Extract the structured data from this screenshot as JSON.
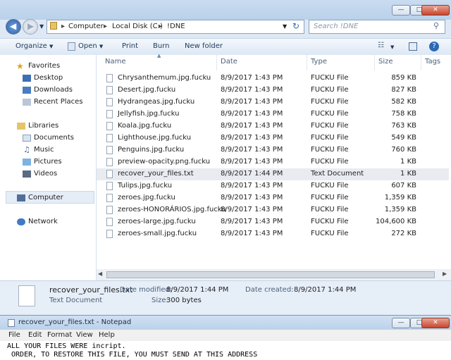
{
  "explorer": {
    "breadcrumb": [
      "Computer",
      "Local Disk (C:)",
      "!DNE"
    ],
    "search_placeholder": "Search !DNE",
    "toolbar": {
      "organize": "Organize",
      "open": "Open",
      "print": "Print",
      "burn": "Burn",
      "new_folder": "New folder"
    },
    "nav": {
      "favorites": "Favorites",
      "desktop": "Desktop",
      "downloads": "Downloads",
      "recent_places": "Recent Places",
      "libraries": "Libraries",
      "documents": "Documents",
      "music": "Music",
      "pictures": "Pictures",
      "videos": "Videos",
      "computer": "Computer",
      "network": "Network"
    },
    "columns": {
      "name": "Name",
      "date": "Date",
      "type": "Type",
      "size": "Size",
      "tags": "Tags"
    },
    "files": [
      {
        "name": "Chrysanthemum.jpg.fucku",
        "date": "8/9/2017 1:43 PM",
        "type": "FUCKU File",
        "size": "859 KB"
      },
      {
        "name": "Desert.jpg.fucku",
        "date": "8/9/2017 1:43 PM",
        "type": "FUCKU File",
        "size": "827 KB"
      },
      {
        "name": "Hydrangeas.jpg.fucku",
        "date": "8/9/2017 1:43 PM",
        "type": "FUCKU File",
        "size": "582 KB"
      },
      {
        "name": "Jellyfish.jpg.fucku",
        "date": "8/9/2017 1:43 PM",
        "type": "FUCKU File",
        "size": "758 KB"
      },
      {
        "name": "Koala.jpg.fucku",
        "date": "8/9/2017 1:43 PM",
        "type": "FUCKU File",
        "size": "763 KB"
      },
      {
        "name": "Lighthouse.jpg.fucku",
        "date": "8/9/2017 1:43 PM",
        "type": "FUCKU File",
        "size": "549 KB"
      },
      {
        "name": "Penguins.jpg.fucku",
        "date": "8/9/2017 1:43 PM",
        "type": "FUCKU File",
        "size": "760 KB"
      },
      {
        "name": "preview-opacity.png.fucku",
        "date": "8/9/2017 1:43 PM",
        "type": "FUCKU File",
        "size": "1 KB"
      },
      {
        "name": "recover_your_files.txt",
        "date": "8/9/2017 1:44 PM",
        "type": "Text Document",
        "size": "1 KB"
      },
      {
        "name": "Tulips.jpg.fucku",
        "date": "8/9/2017 1:43 PM",
        "type": "FUCKU File",
        "size": "607 KB"
      },
      {
        "name": "zeroes.jpg.fucku",
        "date": "8/9/2017 1:43 PM",
        "type": "FUCKU File",
        "size": "1,359 KB"
      },
      {
        "name": "zeroes-HONORÁRIOS.jpg.fucku",
        "date": "8/9/2017 1:43 PM",
        "type": "FUCKU File",
        "size": "1,359 KB"
      },
      {
        "name": "zeroes-large.jpg.fucku",
        "date": "8/9/2017 1:43 PM",
        "type": "FUCKU File",
        "size": "104,600 KB"
      },
      {
        "name": "zeroes-small.jpg.fucku",
        "date": "8/9/2017 1:43 PM",
        "type": "FUCKU File",
        "size": "272 KB"
      }
    ],
    "details": {
      "filename": "recover_your_files.txt",
      "modified_label": "Date modified:",
      "modified_value": "8/9/2017 1:44 PM",
      "created_label": "Date created:",
      "created_value": "8/9/2017 1:44 PM",
      "type": "Text Document",
      "size_label": "Size:",
      "size_value": "300 bytes"
    }
  },
  "notepad": {
    "title": "recover_your_files.txt - Notepad",
    "menu": [
      "File",
      "Edit",
      "Format",
      "View",
      "Help"
    ],
    "lines": [
      "ALL YOUR FILES WERE incript.",
      " ORDER, TO RESTORE THIS FILE, YOU MUST SEND AT THIS ADDRESS"
    ]
  }
}
